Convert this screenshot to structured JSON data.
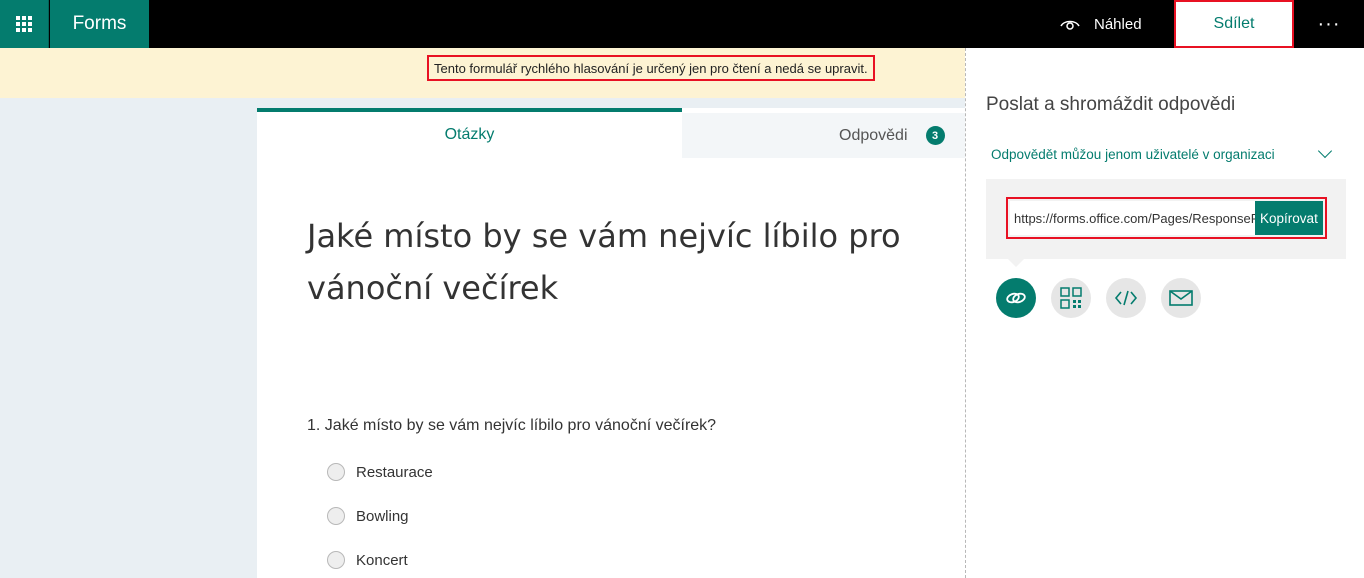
{
  "topbar": {
    "app_name": "Forms",
    "preview_label": "Náhled",
    "share_label": "Sdílet",
    "more_label": "···"
  },
  "banner": {
    "message": "Tento formulář rychlého hlasování je určený jen pro čtení a nedá se upravit."
  },
  "tabs": {
    "questions": "Otázky",
    "responses": "Odpovědi",
    "responses_count": "3"
  },
  "form": {
    "title": "Jaké místo by se vám nejvíc líbilo pro vánoční večírek",
    "question": "1. Jaké místo by se vám nejvíc líbilo pro vánoční večírek?",
    "options": [
      "Restaurace",
      "Bowling",
      "Koncert"
    ]
  },
  "share_panel": {
    "title": "Poslat a shromáždit odpovědi",
    "audience": "Odpovědět můžou jenom uživatelé v organizaci",
    "link_value": "https://forms.office.com/Pages/ResponsePage.aspx",
    "copy_label": "Kopírovat",
    "icons": [
      "link-icon",
      "qr-code-icon",
      "embed-code-icon",
      "email-icon"
    ]
  },
  "colors": {
    "accent": "#047c6e",
    "highlight": "#e81123",
    "banner_bg": "#fdf3d3"
  }
}
